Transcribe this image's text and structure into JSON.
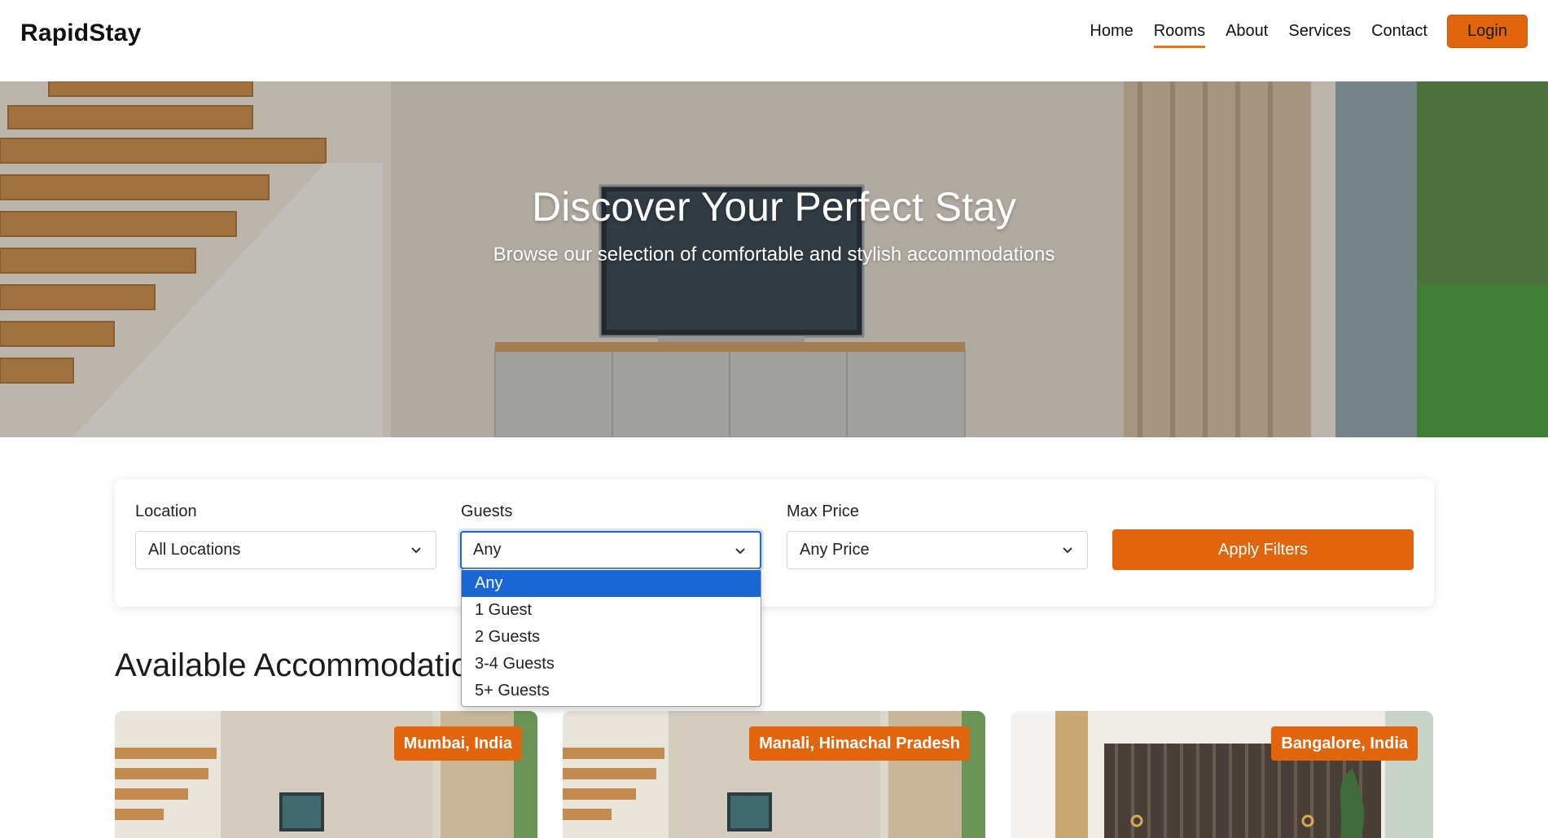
{
  "brand": "RapidStay",
  "nav": {
    "links": [
      {
        "label": "Home"
      },
      {
        "label": "Rooms"
      },
      {
        "label": "About"
      },
      {
        "label": "Services"
      },
      {
        "label": "Contact"
      }
    ],
    "active": "Rooms",
    "login_label": "Login"
  },
  "hero": {
    "title": "Discover Your Perfect Stay",
    "subtitle": "Browse our selection of comfortable and stylish accommodations"
  },
  "filters": {
    "location": {
      "label": "Location",
      "value": "All Locations"
    },
    "guests": {
      "label": "Guests",
      "value": "Any",
      "options": [
        "Any",
        "1 Guest",
        "2 Guests",
        "3-4 Guests",
        "5+ Guests"
      ],
      "open": true
    },
    "max_price": {
      "label": "Max Price",
      "value": "Any Price"
    },
    "apply_label": "Apply Filters"
  },
  "section": {
    "title": "Available Accommodations"
  },
  "cards": [
    {
      "location": "Mumbai, India"
    },
    {
      "location": "Manali, Himachal Pradesh"
    },
    {
      "location": "Bangalore, India"
    }
  ],
  "colors": {
    "accent": "#e0650d",
    "focus": "#1a66d2",
    "selected_option": "#1a66d2"
  },
  "icons": {
    "select_chevron": "chevron-down-icon"
  }
}
